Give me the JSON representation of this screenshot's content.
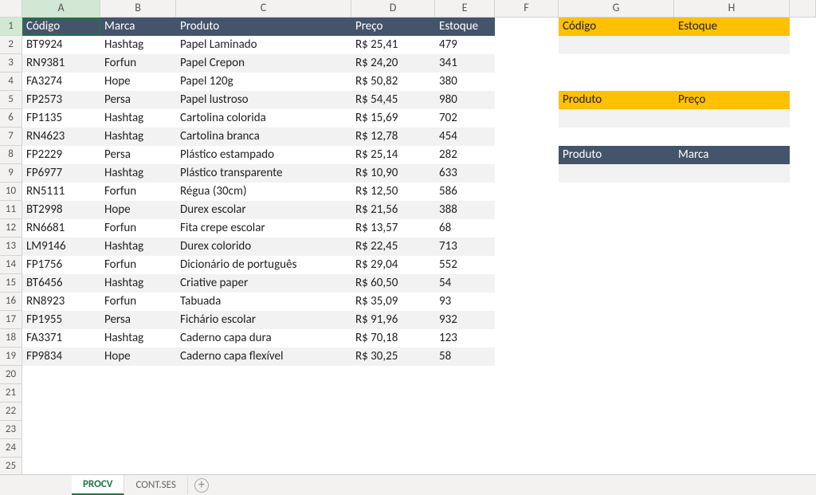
{
  "columns": [
    "A",
    "B",
    "C",
    "D",
    "E",
    "F",
    "G",
    "H"
  ],
  "row_count": 25,
  "active_cell": "A1",
  "main_headers": {
    "A": "Código",
    "B": "Marca",
    "C": "Produto",
    "D": "Preço",
    "E": "Estoque"
  },
  "lookup1": {
    "G": "Código",
    "H": "Estoque",
    "row": 1,
    "style": "gold"
  },
  "lookup2": {
    "G": "Produto",
    "H": "Preço",
    "row": 5,
    "style": "gold"
  },
  "lookup3": {
    "G": "Produto",
    "H": "Marca",
    "row": 8,
    "style": "dark"
  },
  "rows": [
    {
      "A": "BT9924",
      "B": "Hashtag",
      "C": "Papel Laminado",
      "D": "R$ 25,41",
      "E": "479"
    },
    {
      "A": "RN9381",
      "B": "Forfun",
      "C": "Papel Crepon",
      "D": "R$ 24,20",
      "E": "341"
    },
    {
      "A": "FA3274",
      "B": "Hope",
      "C": "Papel 120g",
      "D": "R$ 50,82",
      "E": "380"
    },
    {
      "A": "FP2573",
      "B": "Persa",
      "C": "Papel lustroso",
      "D": "R$ 54,45",
      "E": "980"
    },
    {
      "A": "FP1135",
      "B": "Hashtag",
      "C": "Cartolina colorida",
      "D": "R$ 15,69",
      "E": "702"
    },
    {
      "A": "RN4623",
      "B": "Hashtag",
      "C": "Cartolina branca",
      "D": "R$ 12,78",
      "E": "454"
    },
    {
      "A": "FP2229",
      "B": "Persa",
      "C": "Plástico estampado",
      "D": "R$ 25,14",
      "E": "282"
    },
    {
      "A": "FP6977",
      "B": "Hashtag",
      "C": "Plástico transparente",
      "D": "R$ 10,90",
      "E": "633"
    },
    {
      "A": "RN5111",
      "B": "Forfun",
      "C": "Régua (30cm)",
      "D": "R$ 12,50",
      "E": "586"
    },
    {
      "A": "BT2998",
      "B": "Hope",
      "C": "Durex escolar",
      "D": "R$ 21,56",
      "E": "388"
    },
    {
      "A": "RN6681",
      "B": "Forfun",
      "C": "Fita crepe escolar",
      "D": "R$ 13,57",
      "E": "68"
    },
    {
      "A": "LM9146",
      "B": "Hashtag",
      "C": "Durex colorido",
      "D": "R$ 22,45",
      "E": "713"
    },
    {
      "A": "FP1756",
      "B": "Forfun",
      "C": "Dicionário de português",
      "D": "R$ 29,04",
      "E": "552"
    },
    {
      "A": "BT6456",
      "B": "Hashtag",
      "C": "Criative paper",
      "D": "R$ 60,50",
      "E": "54"
    },
    {
      "A": "RN8923",
      "B": "Forfun",
      "C": "Tabuada",
      "D": "R$ 35,09",
      "E": "93"
    },
    {
      "A": "FP1955",
      "B": "Persa",
      "C": "Fichário escolar",
      "D": "R$ 91,96",
      "E": "932"
    },
    {
      "A": "FA3371",
      "B": "Hashtag",
      "C": "Caderno capa dura",
      "D": "R$ 70,18",
      "E": "123"
    },
    {
      "A": "FP9834",
      "B": "Hope",
      "C": "Caderno capa flexível",
      "D": "R$ 30,25",
      "E": "58"
    }
  ],
  "tabs": {
    "active": "PROCV",
    "items": [
      "PROCV",
      "CONT.SES"
    ]
  },
  "chart_data": {
    "type": "table",
    "title": "Product inventory",
    "columns": [
      "Código",
      "Marca",
      "Produto",
      "Preço (R$)",
      "Estoque"
    ],
    "rows": [
      [
        "BT9924",
        "Hashtag",
        "Papel Laminado",
        25.41,
        479
      ],
      [
        "RN9381",
        "Forfun",
        "Papel Crepon",
        24.2,
        341
      ],
      [
        "FA3274",
        "Hope",
        "Papel 120g",
        50.82,
        380
      ],
      [
        "FP2573",
        "Persa",
        "Papel lustroso",
        54.45,
        980
      ],
      [
        "FP1135",
        "Hashtag",
        "Cartolina colorida",
        15.69,
        702
      ],
      [
        "RN4623",
        "Hashtag",
        "Cartolina branca",
        12.78,
        454
      ],
      [
        "FP2229",
        "Persa",
        "Plástico estampado",
        25.14,
        282
      ],
      [
        "FP6977",
        "Hashtag",
        "Plástico transparente",
        10.9,
        633
      ],
      [
        "RN5111",
        "Forfun",
        "Régua (30cm)",
        12.5,
        586
      ],
      [
        "BT2998",
        "Hope",
        "Durex escolar",
        21.56,
        388
      ],
      [
        "RN6681",
        "Forfun",
        "Fita crepe escolar",
        13.57,
        68
      ],
      [
        "LM9146",
        "Hashtag",
        "Durex colorido",
        22.45,
        713
      ],
      [
        "FP1756",
        "Forfun",
        "Dicionário de português",
        29.04,
        552
      ],
      [
        "BT6456",
        "Hashtag",
        "Criative paper",
        60.5,
        54
      ],
      [
        "RN8923",
        "Forfun",
        "Tabuada",
        35.09,
        93
      ],
      [
        "FP1955",
        "Persa",
        "Fichário escolar",
        91.96,
        932
      ],
      [
        "FA3371",
        "Hashtag",
        "Caderno capa dura",
        70.18,
        123
      ],
      [
        "FP9834",
        "Hope",
        "Caderno capa flexível",
        30.25,
        58
      ]
    ]
  }
}
